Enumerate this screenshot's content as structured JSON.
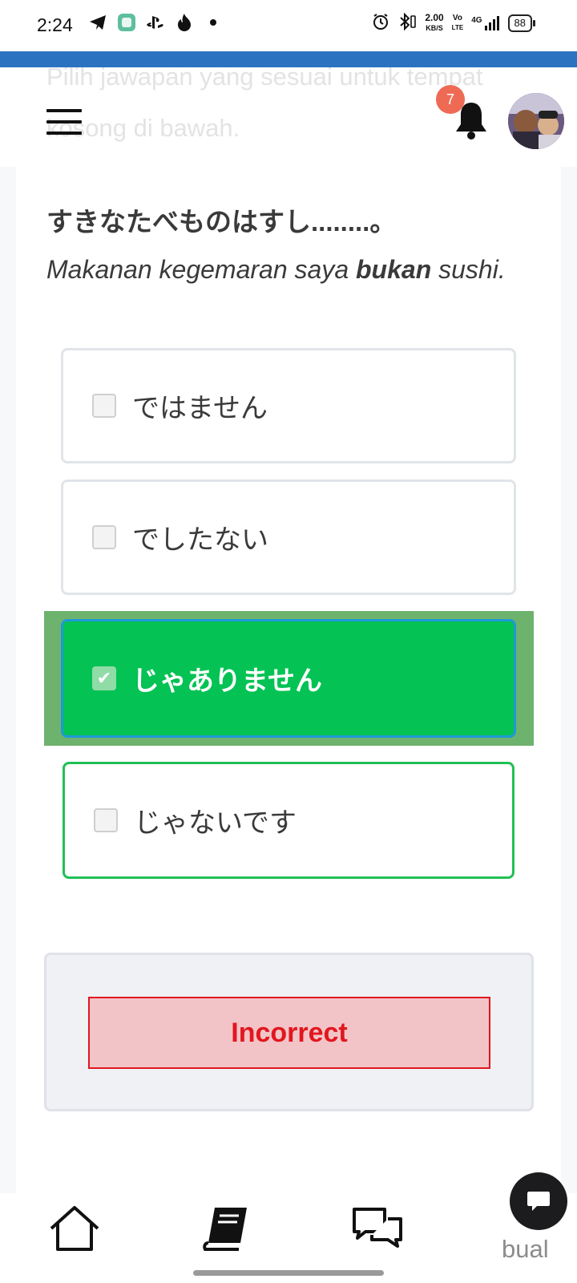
{
  "status_bar": {
    "time": "2:24",
    "left_icons": [
      "telegram-icon",
      "app-icon",
      "playstation-icon",
      "tinder-icon",
      "dot-icon"
    ],
    "speed_value": "2.00",
    "speed_unit": "KB/S",
    "volte_top": "Vo",
    "volte_bottom": "LTE",
    "network": "4G",
    "battery": "88"
  },
  "header": {
    "instruction_text": "Pilih jawapan yang sesuai untuk tempat kosong di bawah.",
    "notification_count": "7"
  },
  "question": {
    "japanese": "すきなたべものはすし........。",
    "translation_before": "Makanan kegemaran saya ",
    "translation_bold": "bukan",
    "translation_after": " sushi."
  },
  "options": [
    {
      "label": "ではません",
      "checked": false
    },
    {
      "label": "でしたない",
      "checked": false
    },
    {
      "label": "じゃありません",
      "checked": true
    },
    {
      "label": "じゃないです",
      "checked": false
    }
  ],
  "feedback": {
    "result": "Incorrect"
  },
  "bottom_nav": {
    "items": [
      "home-icon",
      "book-icon",
      "chat-icon"
    ],
    "fab_label": "bual"
  },
  "colors": {
    "selected_option": "#04c253",
    "correct_border": "#22bf55",
    "incorrect_text": "#e1171f",
    "incorrect_bg": "#f2c4c7",
    "top_accent": "#2b73c1",
    "badge": "#ee6a55"
  }
}
